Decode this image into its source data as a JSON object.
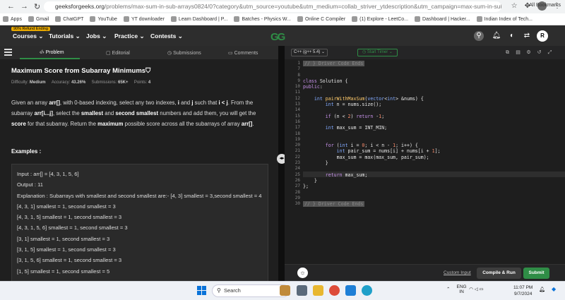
{
  "browser": {
    "url_host": "geeksforgeeks.org",
    "url_path": "/problems/max-sum-in-sub-arrays0824/0?category&utm_source=youtube&utm_medium=collab_striver_ytdescription&utm_campaign=max-sum-in-sub-arrays",
    "bookmarks": [
      "Apps",
      "Gmail",
      "ChatGPT",
      "YouTube",
      "YT downloader",
      "Learn Dashboard | P...",
      "Batches - Physics W...",
      "Online C Compiler",
      "(1) Explore - LeetCo...",
      "Dashboard | Hacker...",
      "Indian Index of Tech..."
    ],
    "all_bookmarks": "All Bookmarks"
  },
  "gfg": {
    "badge": "90% Refund Ending",
    "menu": [
      "Courses",
      "Tutorials",
      "Jobs",
      "Practice",
      "Contests"
    ],
    "logo": "GG",
    "avatar_letter": "R"
  },
  "tabs": [
    "Problem",
    "Editorial",
    "Submissions",
    "Comments"
  ],
  "problem": {
    "title": "Maximum Score from Subarray Minimums",
    "difficulty_label": "Difficulty:",
    "difficulty": "Medium",
    "accuracy_label": "Accuracy:",
    "accuracy": "43.26%",
    "submissions_label": "Submissions:",
    "submissions": "65K+",
    "points_label": "Points:",
    "points": "4",
    "examples_heading": "Examples :"
  },
  "example": {
    "input": "Input : arr[] = [4, 3, 1, 5, 6]",
    "output": "Output : 11",
    "explanation": "Explanation : Subarrays with smallest and second smallest are:- [4, 3] smallest = 3,second smallest = 4",
    "lines": [
      "[4, 3, 1] smallest = 1, second smallest = 3",
      "[4, 3, 1, 5] smallest = 1, second smallest = 3",
      "[4, 3, 1, 5, 6] smallest = 1, second smallest = 3",
      "[3, 1] smallest = 1, second smallest = 3",
      "[3, 1, 5] smallest = 1, second smallest = 3",
      "[3, 1, 5, 6] smallest = 1, second smallest = 3",
      "[1, 5] smallest = 1, second smallest = 5"
    ]
  },
  "editor": {
    "language": "C++ (g++ 5.4)",
    "timer": "Start Timer",
    "folded_label": "// } Driver Code Ends",
    "line_numbers": [
      "1",
      "7",
      "8",
      "9",
      "10",
      "11",
      "12",
      "13",
      "14",
      "15",
      "16",
      "17",
      "18",
      "19",
      "20",
      "21",
      "22",
      "23",
      "24",
      "25",
      "26",
      "27",
      "28",
      "29",
      "30"
    ],
    "custom_input": "Custom Input",
    "compile_run": "Compile & Run",
    "submit": "Submit"
  },
  "taskbar": {
    "search": "Search",
    "lang": "ENG",
    "region": "IN",
    "time": "11:07 PM",
    "date": "9/7/2024"
  }
}
